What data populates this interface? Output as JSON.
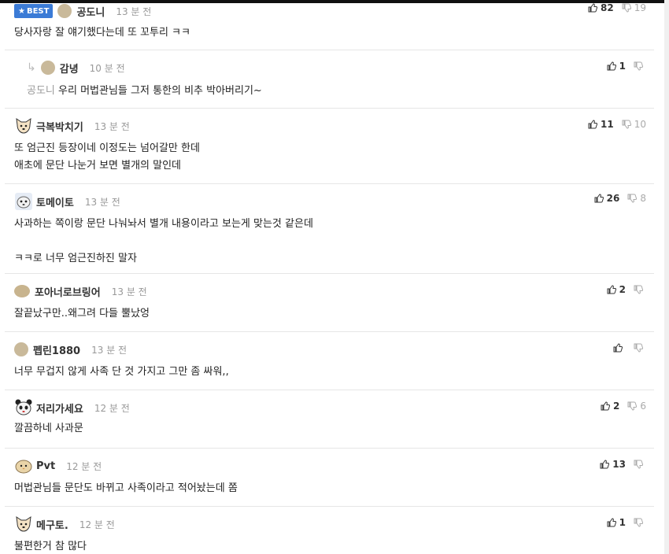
{
  "comments": [
    {
      "badge": "BEST",
      "nick": "공도니",
      "time": "13 분 전",
      "up": "82",
      "down": "19",
      "text": "당사자랑 잘 얘기했다는데 또 꼬투리 ㅋㅋ"
    },
    {
      "nick": "감녕",
      "time": "10 분 전",
      "up": "1",
      "down": "",
      "mention": "공도니",
      "text": "우리 머법관님들 그저 통한의 비추 박아버리기~"
    },
    {
      "nick": "극복박치기",
      "time": "13 분 전",
      "up": "11",
      "down": "10",
      "text": "또 엄근진 등장이네 이정도는 넘어갈만 한데\n애초에 문단 나눈거 보면 별개의 말인데"
    },
    {
      "nick": "토메이토",
      "time": "13 분 전",
      "up": "26",
      "down": "8",
      "text": "사과하는 쪽이랑 문단 나눠놔서 별개 내용이라고 보는게 맞는것 같은데\n\nㅋㅋ로 너무 엄근진하진 말자"
    },
    {
      "nick": "포아너로브링어",
      "time": "13 분 전",
      "up": "2",
      "down": "",
      "text": "잘끝났구만..왜그려 다들 뿔났엉"
    },
    {
      "nick": "펩린1880",
      "time": "13 분 전",
      "up": "",
      "down": "",
      "text": "너무 무겁지 않게 사족 단 것 가지고 그만 좀 싸워,,"
    },
    {
      "nick": "저리가세요",
      "time": "12 분 전",
      "up": "2",
      "down": "6",
      "text": "깔끔하네 사과문"
    },
    {
      "nick": "Pvt",
      "time": "12 분 전",
      "up": "13",
      "down": "",
      "text": "머법관님들 문단도 바뀌고 사족이라고 적어놨는데 쫌"
    },
    {
      "nick": "메구토.",
      "time": "12 분 전",
      "up": "1",
      "down": "",
      "text": "불편한거 참 많다"
    }
  ],
  "colors": {
    "badge": "#3b7bd6",
    "time": "#999999",
    "divider": "#e6e6e6"
  }
}
